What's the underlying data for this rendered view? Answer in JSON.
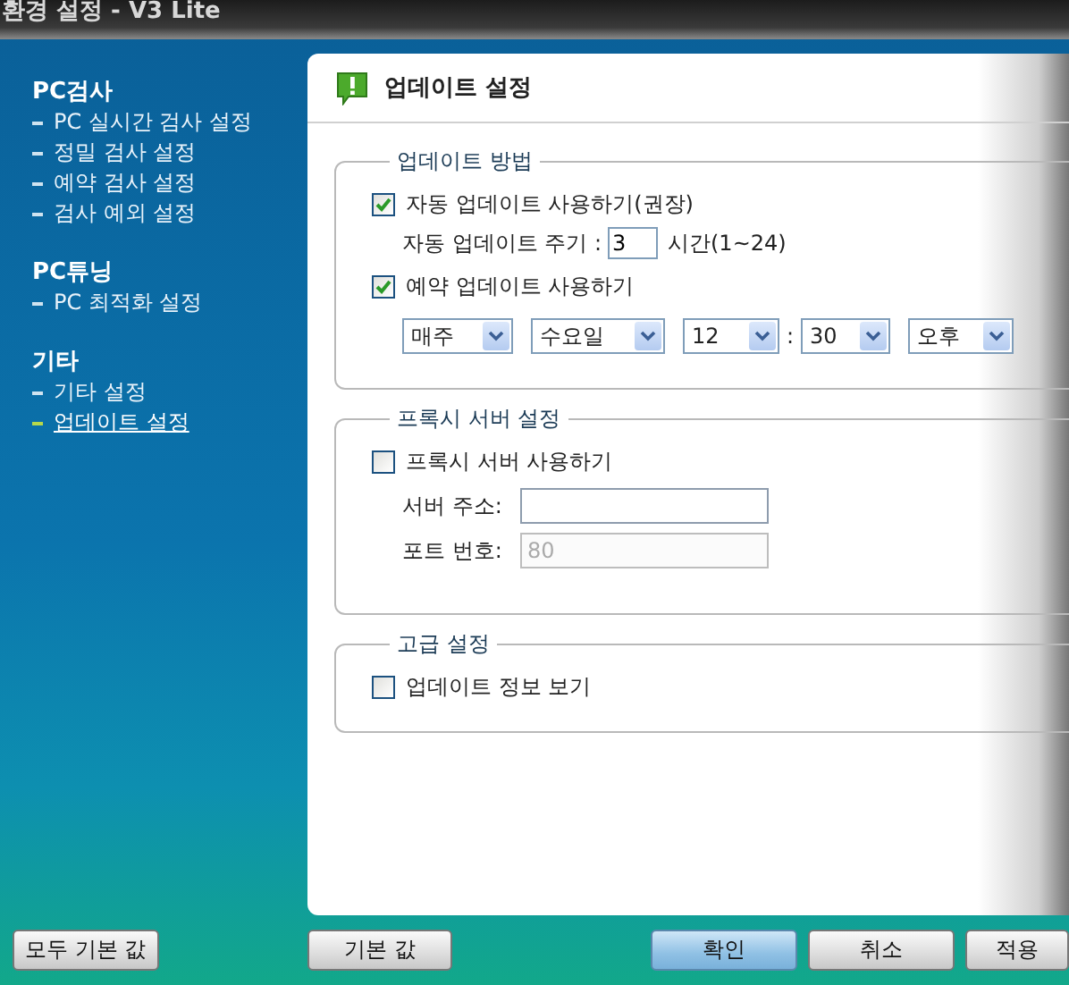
{
  "window": {
    "title": "환경 설정 - V3 Lite"
  },
  "sidebar": {
    "sections": [
      {
        "title": "PC검사",
        "items": [
          {
            "label": "PC 실시간 검사 설정",
            "selected": false
          },
          {
            "label": "정밀 검사 설정",
            "selected": false
          },
          {
            "label": "예약 검사 설정",
            "selected": false
          },
          {
            "label": "검사 예외 설정",
            "selected": false
          }
        ]
      },
      {
        "title": "PC튜닝",
        "items": [
          {
            "label": "PC 최적화 설정",
            "selected": false
          }
        ]
      },
      {
        "title": "기타",
        "items": [
          {
            "label": "기타 설정",
            "selected": false
          },
          {
            "label": "업데이트 설정",
            "selected": true
          }
        ]
      }
    ]
  },
  "panel": {
    "title": "업데이트 설정",
    "groups": [
      {
        "title": "업데이트 방법",
        "rows": [
          {
            "kind": "checkbox",
            "label": "자동 업데이트 사용하기(권장)",
            "checked": true
          },
          {
            "kind": "interval",
            "label": "자동 업데이트 주기 :",
            "value": "3",
            "unit": "시간(1~24)"
          },
          {
            "kind": "checkbox",
            "label": "예약 업데이트 사용하기",
            "checked": true
          },
          {
            "kind": "schedule",
            "parts": [
              {
                "kind": "select",
                "value": "매주"
              },
              {
                "kind": "select",
                "value": "수요일"
              },
              {
                "kind": "select",
                "value": "12"
              },
              {
                "kind": "sep",
                "text": ":"
              },
              {
                "kind": "select",
                "value": "30"
              },
              {
                "kind": "select",
                "value": "오후"
              }
            ]
          }
        ]
      },
      {
        "title": "프록시 서버 설정",
        "rows": [
          {
            "kind": "checkbox",
            "label": "프록시 서버 사용하기",
            "checked": false
          },
          {
            "kind": "field",
            "label": "서버 주소:",
            "disabled": false
          },
          {
            "kind": "field",
            "label": "포트 번호:",
            "value": "80",
            "disabled": true
          }
        ]
      },
      {
        "title": "고급 설정",
        "rows": [
          {
            "kind": "checkbox",
            "label": "업데이트 정보 보기",
            "checked": false
          }
        ]
      }
    ]
  },
  "buttons": [
    {
      "label": "모두 기본 값",
      "primary": false
    },
    {
      "label": "기본 값",
      "primary": false
    },
    {
      "label": "확인",
      "primary": true
    },
    {
      "label": "취소",
      "primary": false
    },
    {
      "label": "적용",
      "primary": false
    }
  ]
}
